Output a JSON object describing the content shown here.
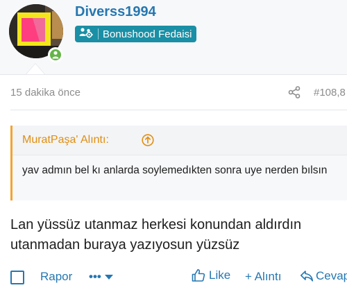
{
  "user": {
    "username": "Diverss1994",
    "badge_label": "Bonushood Fedaisi",
    "online": true
  },
  "post": {
    "time": "15 dakika önce",
    "number": "#108,8"
  },
  "quote": {
    "author_label": "MuratPaşa' Alıntı:",
    "text": "yav admın bel kı anlarda soylemedıkten sonra uye nerden bılsın"
  },
  "message": {
    "text": "Lan yüssüz utanmaz herkesi konundan aldırdın utanmadan buraya yazıyosun yüzsüz"
  },
  "actions": {
    "report_label": "Rapor",
    "more_label": "•••",
    "like_label": "Like",
    "quote_label": "+ Alıntı",
    "reply_label": "Cevap"
  },
  "colors": {
    "link": "#2577b1",
    "badge_bg": "#1a8fa5",
    "quote_accent": "#f4a42c",
    "online": "#63b547"
  }
}
